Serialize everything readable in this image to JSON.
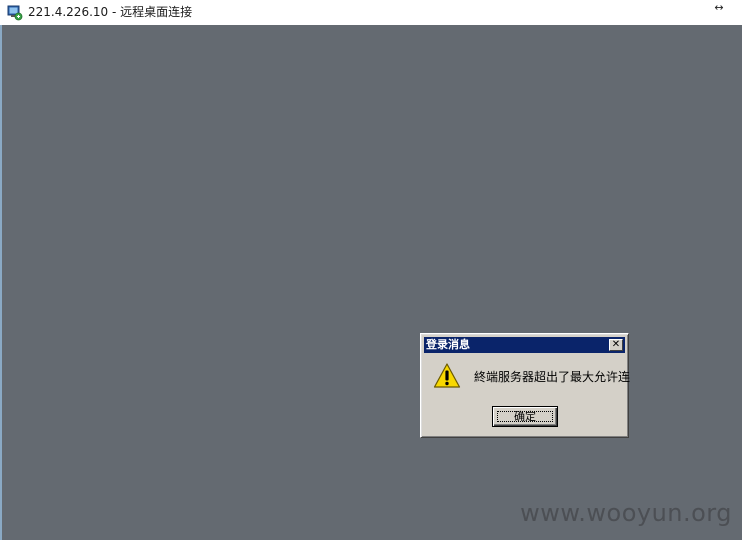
{
  "window": {
    "title": "221.4.226.10 - 远程桌面连接",
    "resize_glyph": "↔",
    "icon": "remote-desktop-icon"
  },
  "dialog": {
    "title": "登录消息",
    "close_glyph": "✕",
    "message": "終端服务器超出了最大允许连",
    "ok_label": "确定",
    "icon": "warning-icon"
  },
  "watermark": "www.wooyun.org",
  "colors": {
    "desktop": "#646a71",
    "dialog_face": "#d4d0c8",
    "dialog_titlebar": "#0a246a",
    "warning_fill": "#f8d800"
  }
}
